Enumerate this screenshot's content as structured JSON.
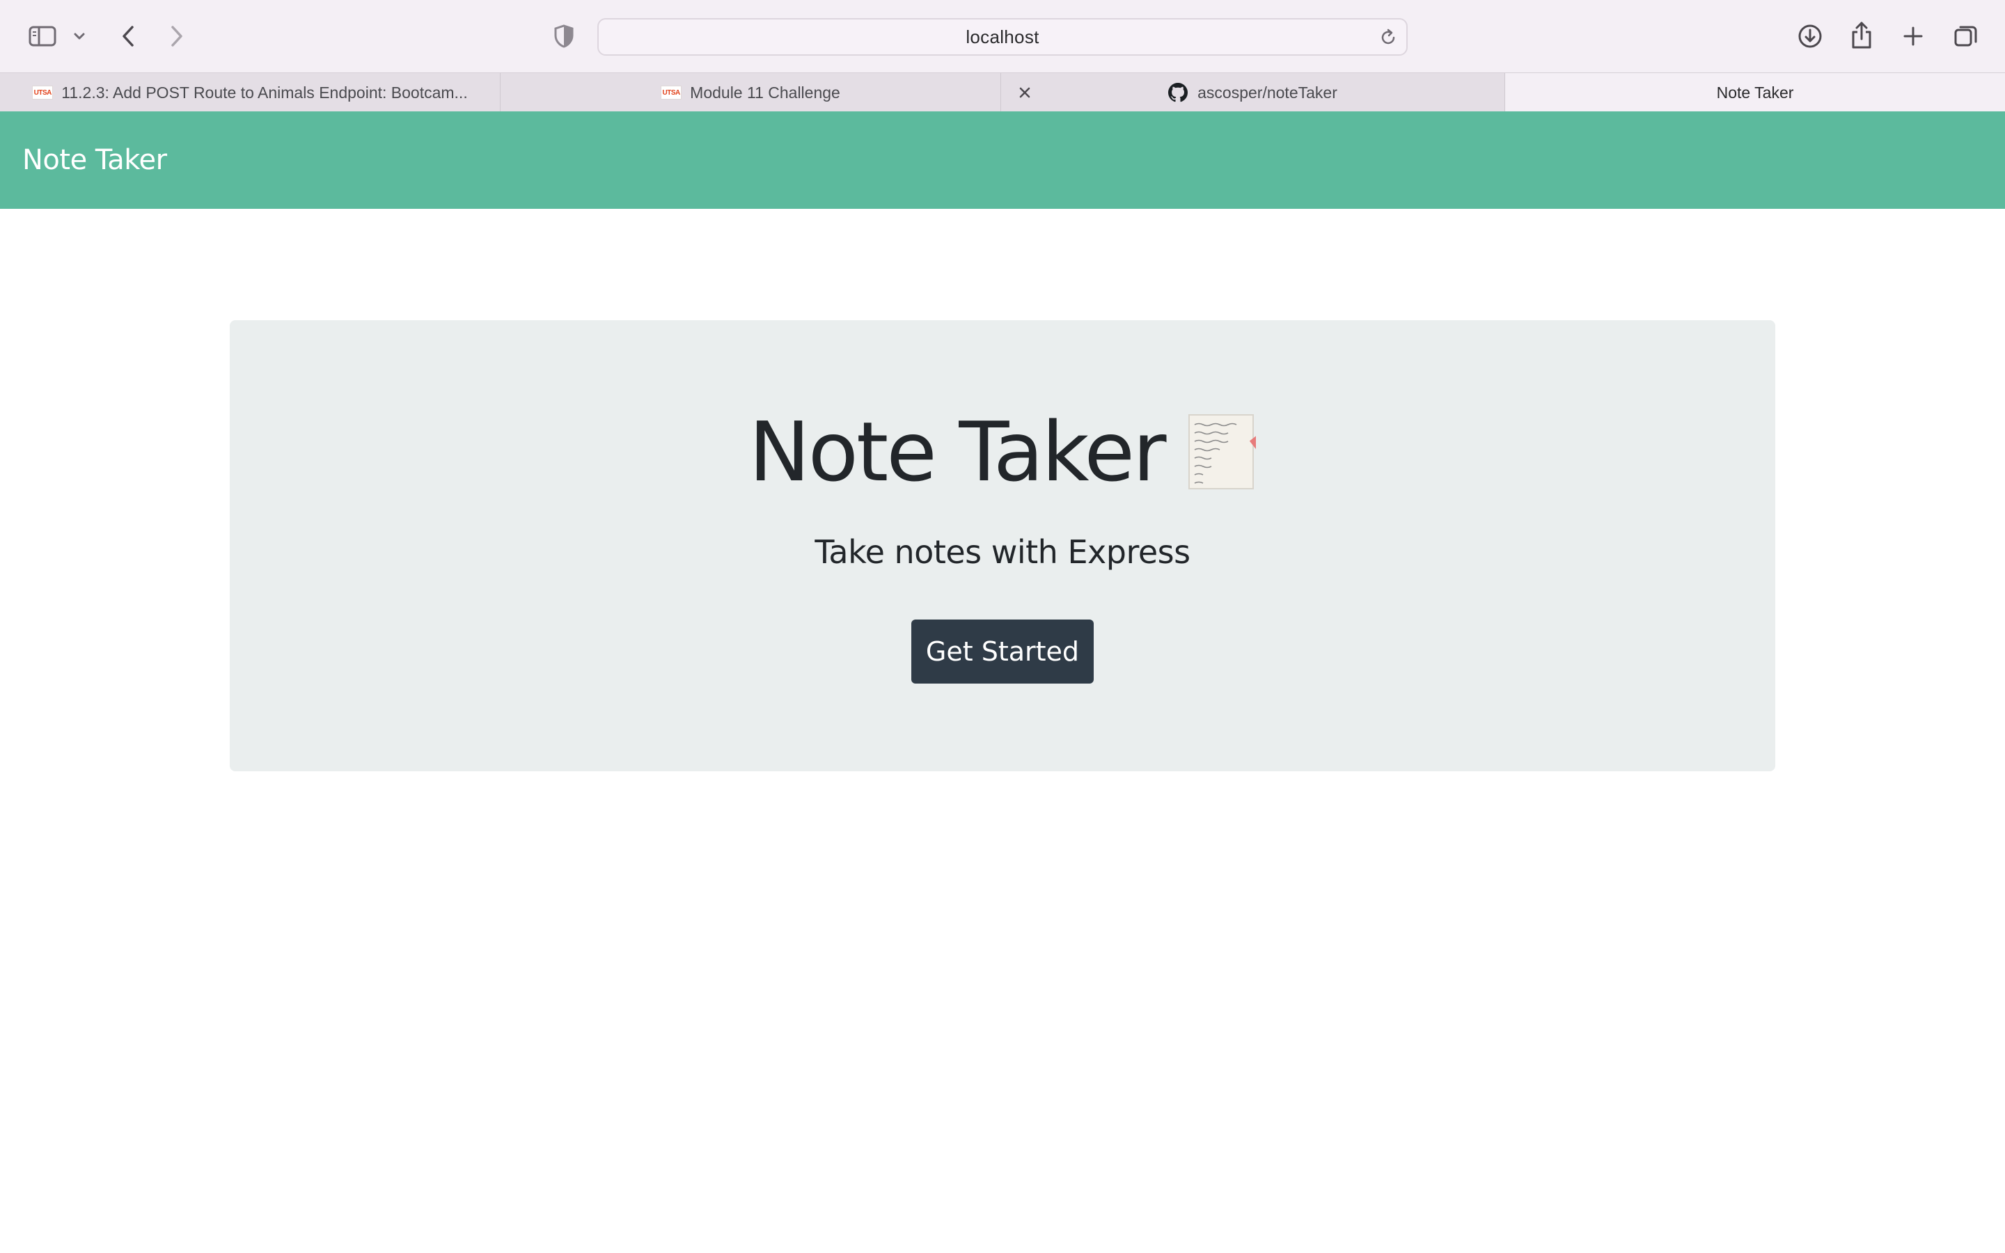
{
  "browser": {
    "address": "localhost",
    "tabs": [
      {
        "label": "11.2.3: Add POST Route to Animals Endpoint: Bootcam...",
        "favicon": "utsa-logo-icon"
      },
      {
        "label": "Module 11 Challenge",
        "favicon": "utsa-logo-icon"
      },
      {
        "label": "ascosper/noteTaker",
        "favicon": "github-icon"
      },
      {
        "label": "Note Taker",
        "active": true
      }
    ],
    "favicon_text": "UTSA"
  },
  "navbar": {
    "brand": "Note Taker",
    "color": "#5cba9d"
  },
  "jumbotron": {
    "title": "Note Taker",
    "icon": "memo-pencil-icon",
    "subtitle": "Take notes with Express",
    "button_label": "Get Started",
    "button_color": "#2f3b47"
  }
}
